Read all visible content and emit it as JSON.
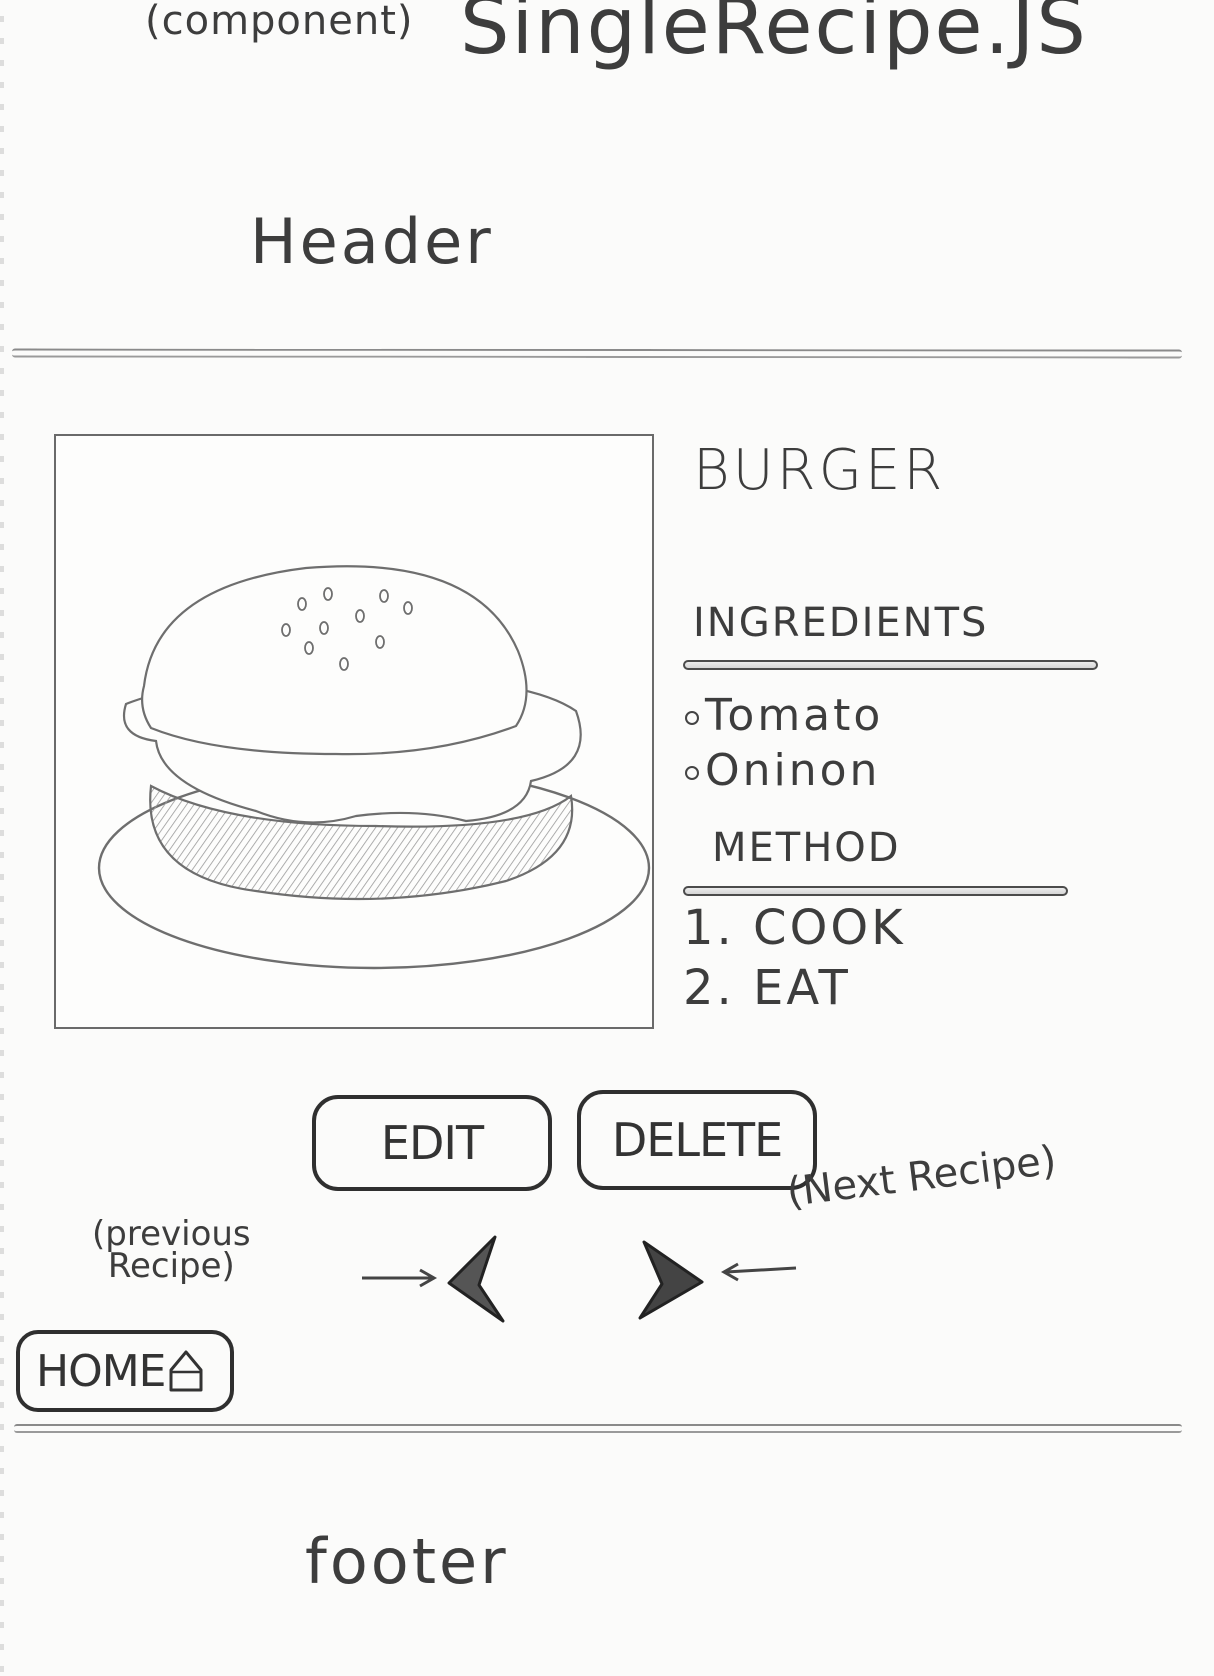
{
  "title": {
    "prefix": "(component)",
    "main": "SingleRecipe.JS"
  },
  "header": {
    "label": "Header"
  },
  "recipe": {
    "title": "BURGER",
    "image_alt": "burger-sketch",
    "ingredients_heading": "INGREDIENTS",
    "ingredients": [
      "Tomato",
      "Oninon"
    ],
    "method_heading": "METHOD",
    "method": [
      "1. COOK",
      "2. EAT"
    ]
  },
  "actions": {
    "edit_label": "EDIT",
    "delete_label": "DELETE"
  },
  "navigation": {
    "previous_annotation_line1": "(previous",
    "previous_annotation_line2": "Recipe)",
    "next_annotation": "(Next Recipe)",
    "home_label": "HOME"
  },
  "footer": {
    "label": "footer"
  },
  "icons": {
    "previous": "chevron-left-icon",
    "next": "chevron-right-icon",
    "home": "home-icon"
  }
}
